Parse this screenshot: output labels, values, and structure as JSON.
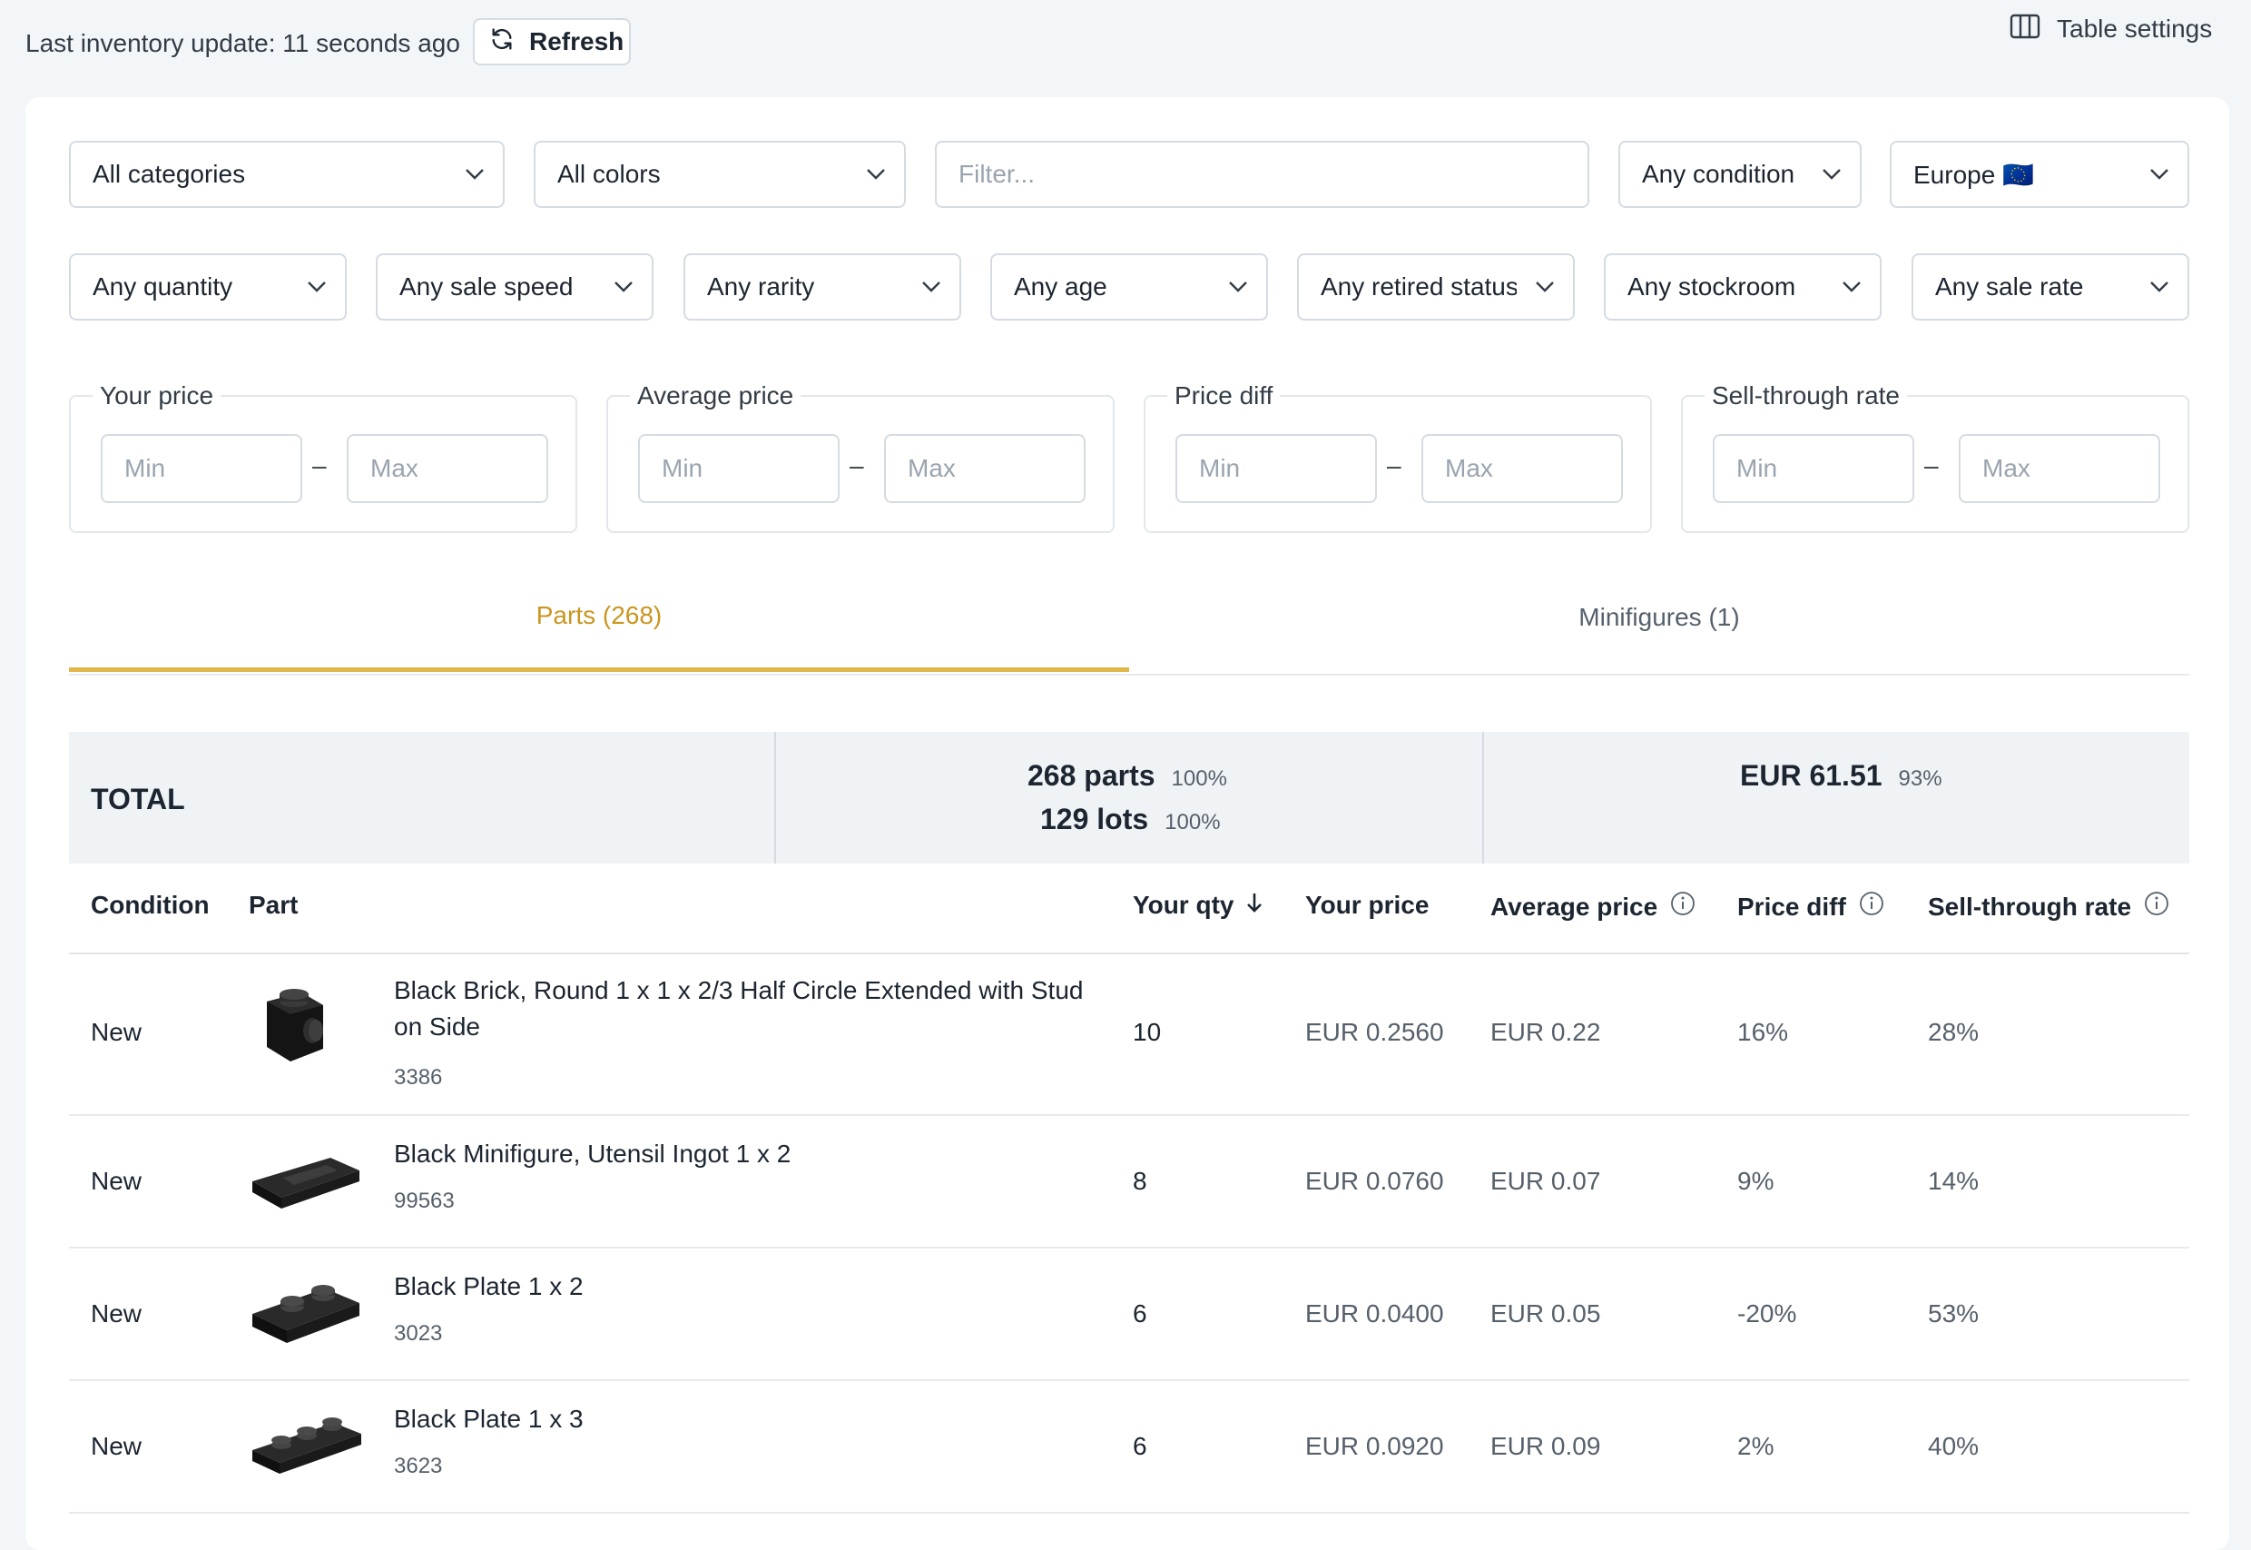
{
  "topbar": {
    "last_update": "Last inventory update: 11 seconds ago",
    "refresh_label": "Refresh",
    "table_settings_label": "Table settings"
  },
  "filters": {
    "category": "All categories",
    "color": "All colors",
    "search_placeholder": "Filter...",
    "condition": "Any condition",
    "region": "Europe 🇪🇺",
    "quantity": "Any quantity",
    "sale_speed": "Any sale speed",
    "rarity": "Any rarity",
    "age": "Any age",
    "retired_status": "Any retired status",
    "stockroom": "Any stockroom",
    "sale_rate": "Any sale rate"
  },
  "ranges": [
    {
      "label": "Your price",
      "min": "Min",
      "max": "Max"
    },
    {
      "label": "Average price",
      "min": "Min",
      "max": "Max"
    },
    {
      "label": "Price diff",
      "min": "Min",
      "max": "Max"
    },
    {
      "label": "Sell-through rate",
      "min": "Min",
      "max": "Max"
    }
  ],
  "range_separator": "–",
  "tabs": [
    {
      "label": "Parts (268)",
      "active": true
    },
    {
      "label": "Minifigures (1)",
      "active": false
    }
  ],
  "total": {
    "label": "TOTAL",
    "parts": "268 parts",
    "parts_pct": "100%",
    "lots": "129 lots",
    "lots_pct": "100%",
    "value": "EUR 61.51",
    "value_pct": "93%"
  },
  "columns": {
    "condition": "Condition",
    "part": "Part",
    "your_qty": "Your qty",
    "your_price": "Your price",
    "average_price": "Average price",
    "price_diff": "Price diff",
    "sell_through": "Sell-through rate"
  },
  "rows": [
    {
      "condition": "New",
      "name": "Black Brick, Round 1 x 1 x 2/3 Half Circle Extended with Stud on Side",
      "number": "3386",
      "qty": "10",
      "your_price": "EUR 0.2560",
      "avg_price": "EUR 0.22",
      "price_diff": "16%",
      "sell_through": "28%"
    },
    {
      "condition": "New",
      "name": "Black Minifigure, Utensil Ingot 1 x 2",
      "number": "99563",
      "qty": "8",
      "your_price": "EUR 0.0760",
      "avg_price": "EUR 0.07",
      "price_diff": "9%",
      "sell_through": "14%"
    },
    {
      "condition": "New",
      "name": "Black Plate 1 x 2",
      "number": "3023",
      "qty": "6",
      "your_price": "EUR 0.0400",
      "avg_price": "EUR 0.05",
      "price_diff": "-20%",
      "sell_through": "53%"
    },
    {
      "condition": "New",
      "name": "Black Plate 1 x 3",
      "number": "3623",
      "qty": "6",
      "your_price": "EUR 0.0920",
      "avg_price": "EUR 0.09",
      "price_diff": "2%",
      "sell_through": "40%"
    }
  ],
  "colors": {
    "accent": "#c9961e",
    "accent_underline": "#e2b749",
    "background": "#f3f6f9",
    "total_bar": "#f0f3f6"
  }
}
